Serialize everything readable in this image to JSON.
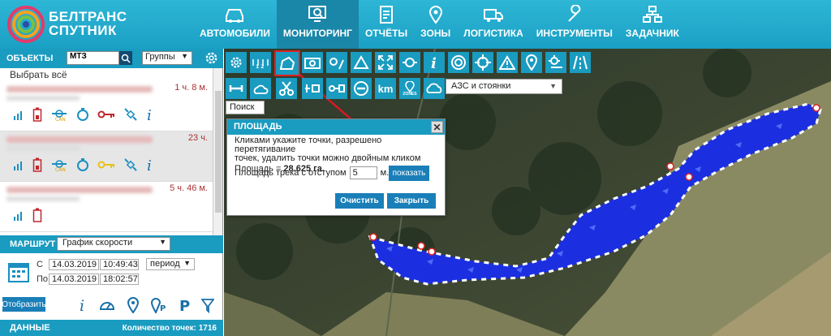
{
  "header": {
    "brand_line1": "БЕЛТРАНС",
    "brand_line2": "СПУТНИК",
    "nav": [
      {
        "label": "АВТОМОБИЛИ",
        "icon": "car-icon"
      },
      {
        "label": "МОНИТОРИНГ",
        "icon": "monitor-search-icon"
      },
      {
        "label": "ОТЧЁТЫ",
        "icon": "report-icon"
      },
      {
        "label": "ЗОНЫ",
        "icon": "location-pin-icon"
      },
      {
        "label": "ЛОГИСТИКА",
        "icon": "truck-icon"
      },
      {
        "label": "ИНСТРУМЕНТЫ",
        "icon": "wrench-icon"
      },
      {
        "label": "ЗАДАЧНИК",
        "icon": "tasks-icon"
      }
    ],
    "active_index": 1
  },
  "objects": {
    "title": "ОБЪЕКТЫ",
    "search_value": "МТЗ",
    "groups_label": "Группы",
    "select_all": "Выбрать всё",
    "items": [
      {
        "time": "1 ч. 8 м."
      },
      {
        "time": "23 ч."
      },
      {
        "time": "5 ч. 46 м."
      }
    ]
  },
  "route": {
    "title": "МАРШРУТ",
    "mode": "График скорости",
    "from_label": "С",
    "to_label": "По",
    "from_date": "14.03.2019",
    "from_time": "10:49:43",
    "to_date": "14.03.2019",
    "to_time": "18:02:57",
    "period": "период",
    "show_button": "Отобразить"
  },
  "data_bar": {
    "title": "ДАННЫЕ",
    "points": "Количество точек: 1716"
  },
  "map": {
    "azs_select": "АЗС и стоянки",
    "search_placeholder": "Поиск",
    "toolbar_km": "km",
    "toolbar_zones": "ZONES"
  },
  "dialog": {
    "title": "ПЛОЩАДЬ",
    "line1": "Кликами укажите точки, разрешено перетягивание",
    "line2": "точек, удалить точки можно двойным кликом",
    "area_label": "Площадь = ",
    "area_value": "28.625 га.",
    "offset_label": "Площадь трека с отступом",
    "offset_value": "5",
    "offset_unit": "м.",
    "show_button": "показать",
    "clear_button": "Очистить",
    "close_button": "Закрыть"
  },
  "colors": {
    "header": "#1fa8cc",
    "accent": "#1a9bc0",
    "button": "#1a7fb8",
    "track": "#1b2fe0",
    "arrow": "#d71920"
  }
}
